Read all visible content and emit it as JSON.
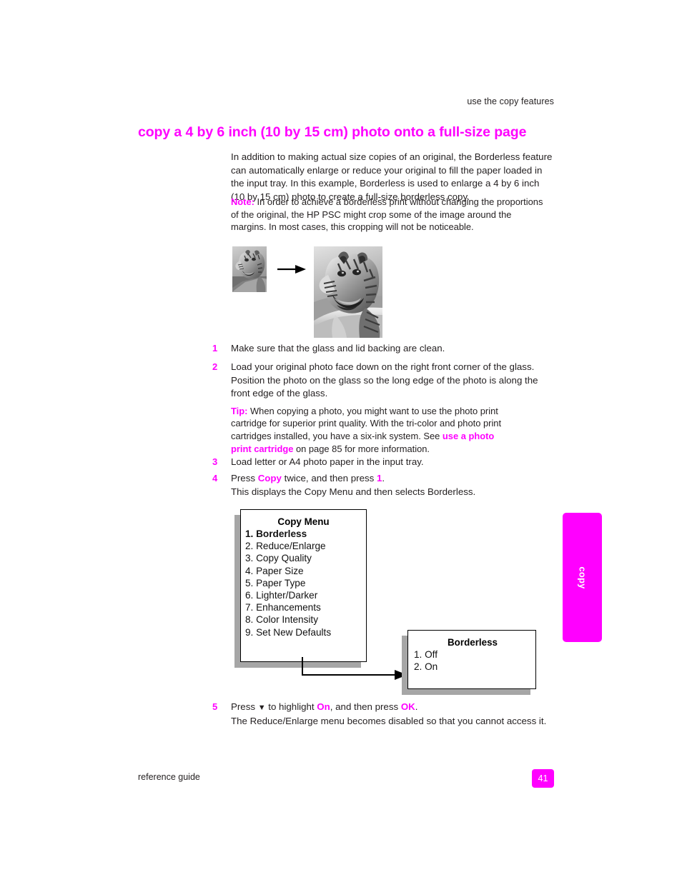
{
  "header": {
    "running_head": "use the copy features"
  },
  "title": "copy a 4 by 6 inch (10 by 15 cm) photo onto a full-size page",
  "intro": "In addition to making actual size copies of an original, the Borderless feature can automatically enlarge or reduce your original to fill the paper loaded in the input tray. In this example, Borderless is used to enlarge a 4 by 6 inch (10 by 15 cm) photo to create a full-size borderless copy.",
  "note": {
    "label": "Note:",
    "text": "In order to achieve a borderless print without changing the proportions of the original, the HP PSC might crop some of the image around the margins. In most cases, this cropping will not be noticeable."
  },
  "figure": {
    "small_photo_alt": "small 4 by 6 inch tiger photo",
    "large_photo_alt": "enlarged full-size tiger photo",
    "arrow_alt": "enlarge arrow"
  },
  "steps": [
    {
      "num": "1",
      "text": "Make sure that the glass and lid backing are clean."
    },
    {
      "num": "2",
      "text": "Load your original photo face down on the right front corner of the glass. Position the photo on the glass so the long edge of the photo is along the front edge of the glass.",
      "tip": {
        "label": "Tip:",
        "text_1": "When copying a photo, you might want to use the photo print cartridge for superior print quality. With the tri-color and photo print cartridges installed, you have a six-ink system. See ",
        "link": "use a photo print cartridge",
        "text_2": " on page 85 for more information."
      }
    },
    {
      "num": "3",
      "text": "Load letter or A4 photo paper in the input tray."
    },
    {
      "num": "4",
      "text_1": "Press ",
      "emphasis_1": "Copy",
      "text_2": " twice, and then press ",
      "emphasis_2": "1",
      "text_3": ".",
      "sub": "This displays the Copy Menu and then selects Borderless."
    },
    {
      "num": "5",
      "text_1": "Press ",
      "glyph": "▼",
      "text_2": " to highlight ",
      "emphasis_1": "On",
      "text_3": ", and then press ",
      "emphasis_2": "OK",
      "text_4": ".",
      "sub": "The Reduce/Enlarge menu becomes disabled so that you cannot access it."
    }
  ],
  "copy_menu": {
    "title": "Copy Menu",
    "items": [
      "1. Borderless",
      "2. Reduce/Enlarge",
      "3. Copy Quality",
      "4. Paper Size",
      "5. Paper Type",
      "6. Lighter/Darker",
      "7. Enhancements",
      "8. Color Intensity",
      "9. Set New Defaults"
    ]
  },
  "borderless_menu": {
    "title": "Borderless",
    "items": [
      "1. Off",
      "2. On"
    ]
  },
  "thumb_tab": {
    "label": "copy"
  },
  "footer": {
    "guide_label": "reference guide",
    "page_number": "41"
  },
  "colors": {
    "accent_magenta": "#FF00FF",
    "body_text": "#231F20",
    "shadow_gray": "#A6A6A6"
  }
}
